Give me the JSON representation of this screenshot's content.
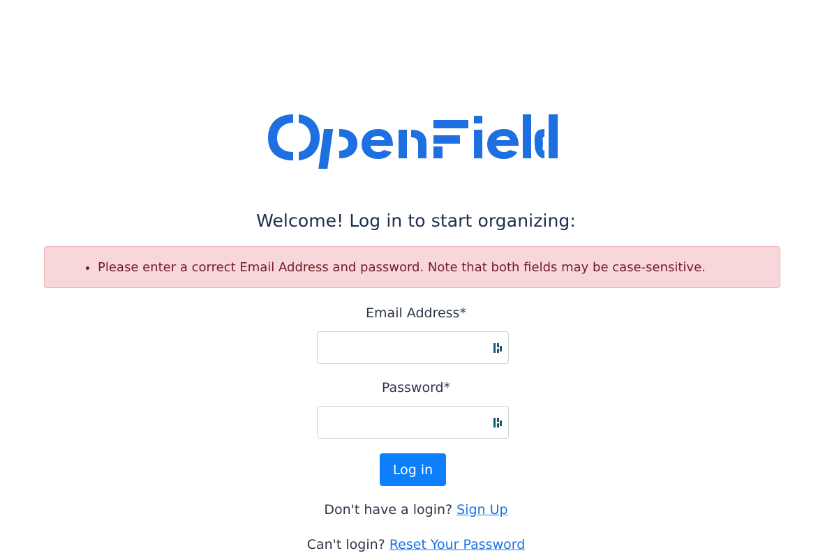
{
  "brand": {
    "logo_text": "OpenField",
    "color": "#1e6fe0"
  },
  "heading": "Welcome! Log in to start organizing:",
  "errors": [
    "Please enter a correct Email Address and password. Note that both fields may be case-sensitive."
  ],
  "form": {
    "email_label": "Email Address*",
    "email_value": "",
    "password_label": "Password*",
    "password_value": "",
    "password_manager_icon": "password-manager-icon",
    "submit_label": "Log in"
  },
  "footer": {
    "signup_prompt": "Don't have a login?",
    "signup_link": "Sign Up",
    "reset_prompt": "Can't login?",
    "reset_link": "Reset Your Password"
  },
  "colors": {
    "accent": "#0d7ffb",
    "error_bg": "#f8d7da",
    "error_text": "#721c24",
    "link": "#1a73e8"
  }
}
